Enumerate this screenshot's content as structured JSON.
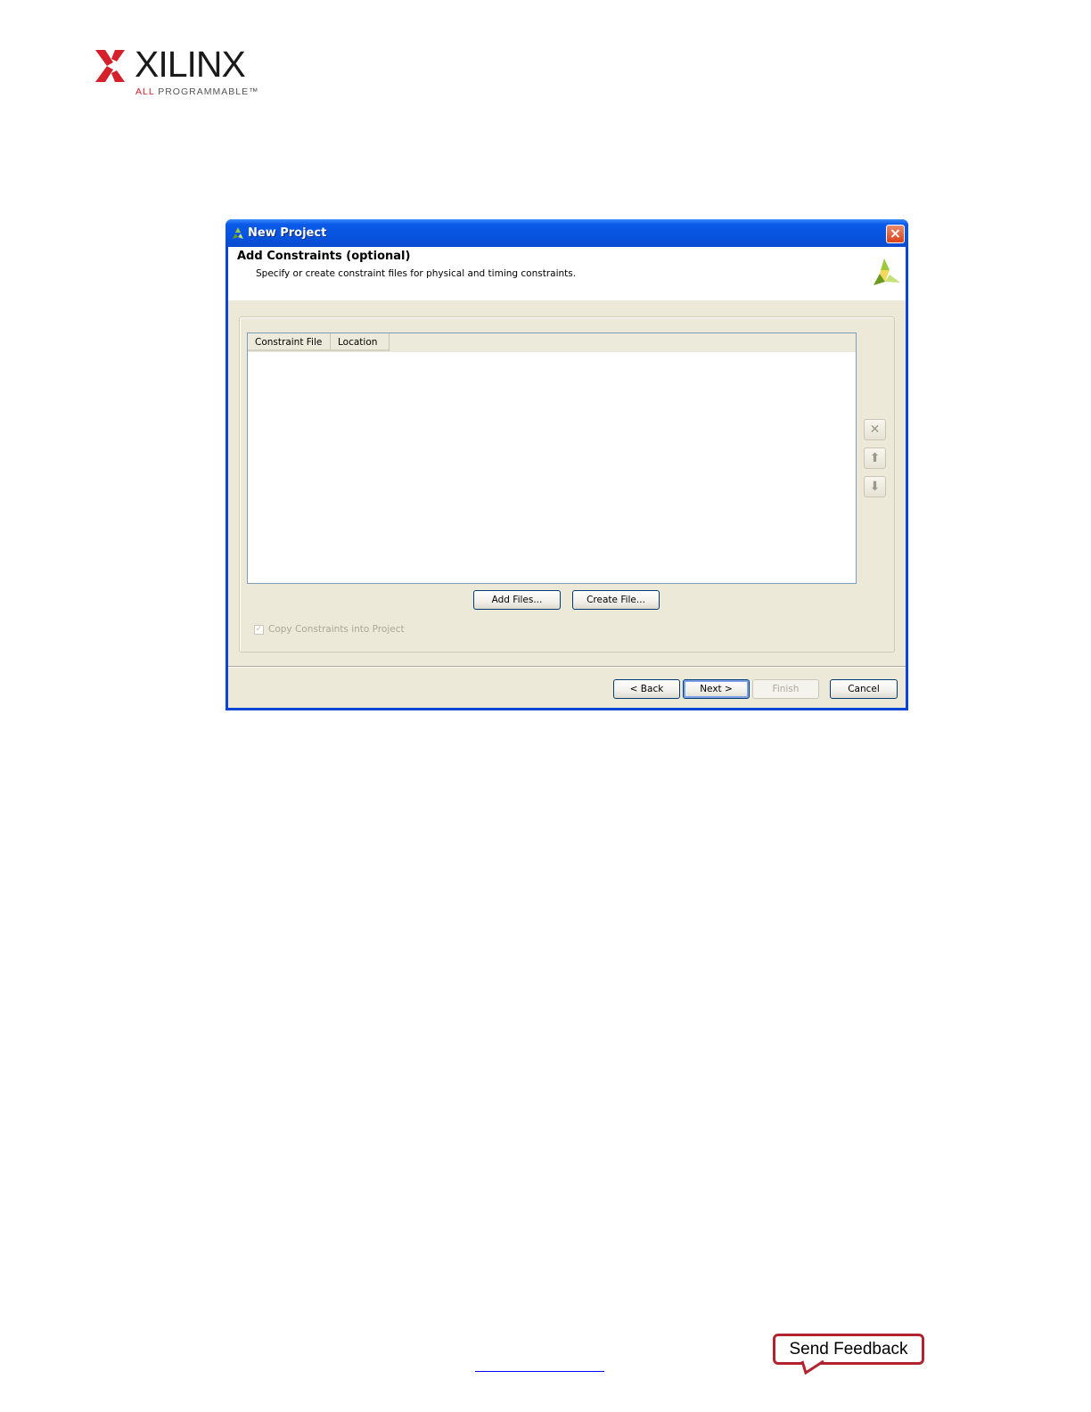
{
  "logo": {
    "wordmark": "XILINX",
    "tagline_prefix": "ALL",
    "tagline_rest": "PROGRAMMABLE",
    "brand_color": "#d4202a"
  },
  "window": {
    "title": "New Project",
    "icon": "vivado-logo-icon",
    "close_icon": "close-icon"
  },
  "header": {
    "title": "Add Constraints (optional)",
    "subtitle": "Specify or create constraint files for physical and timing constraints."
  },
  "table": {
    "columns": [
      "Constraint File",
      "Location"
    ],
    "rows": []
  },
  "side_buttons": {
    "remove": "✕",
    "move_up": "⬆",
    "move_down": "⬇"
  },
  "buttons": {
    "add_files": "Add Files...",
    "create_file": "Create File...",
    "back": "< Back",
    "next": "Next >",
    "finish": "Finish",
    "cancel": "Cancel"
  },
  "options": {
    "copy_constraints_label": "Copy Constraints into Project",
    "copy_constraints_checked": true
  },
  "footer": {
    "send_feedback": "Send Feedback"
  }
}
